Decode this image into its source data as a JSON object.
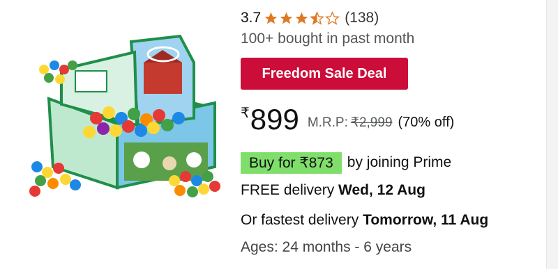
{
  "product": {
    "image_alt": "ball pit play tent with colorful balls",
    "rating": "3.7",
    "stars_value": 3.5,
    "stars_max": 5,
    "review_count": "(138)",
    "bought_text": "100+ bought in past month",
    "deal_badge": "Freedom Sale Deal",
    "price": {
      "currency": "₹",
      "amount": "899",
      "mrp_label": "M.R.P:",
      "mrp_value": "₹2,999",
      "discount": "(70% off)"
    },
    "prime": {
      "chip": "Buy for ₹873",
      "suffix": "by joining Prime"
    },
    "delivery": {
      "free_prefix": "FREE delivery",
      "free_date": "Wed, 12 Aug",
      "fast_prefix": "Or fastest delivery",
      "fast_date": "Tomorrow, 11 Aug"
    },
    "ages": "Ages: 24 months - 6 years"
  },
  "colors": {
    "star": "#de7921",
    "deal": "#cc0c39",
    "prime_chip": "#7fdf6a"
  }
}
